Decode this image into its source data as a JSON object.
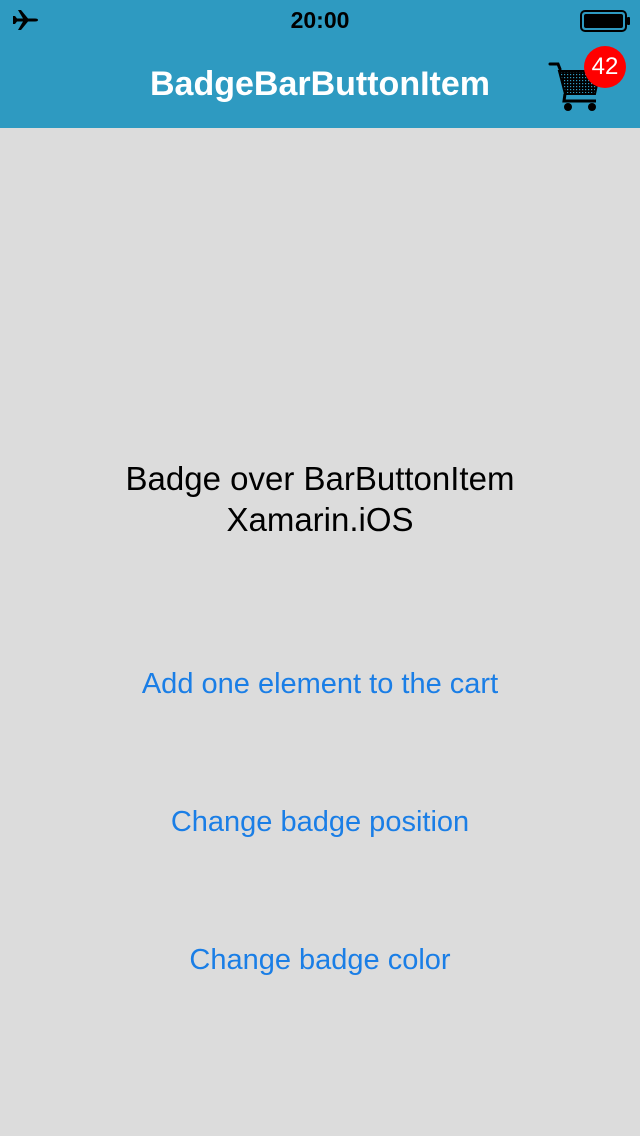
{
  "status_bar": {
    "time": "20:00",
    "left_icon": "airplane-icon",
    "right_icon": "battery-icon"
  },
  "nav_bar": {
    "title": "BadgeBarButtonItem",
    "cart_icon": "shopping-cart-icon",
    "badge_value": "42"
  },
  "main": {
    "description_line1": "Badge over BarButtonItem",
    "description_line2": "Xamarin.iOS",
    "buttons": [
      {
        "label": "Add one element to the cart"
      },
      {
        "label": "Change badge position"
      },
      {
        "label": "Change badge color"
      }
    ]
  },
  "colors": {
    "nav_background": "#2e9ac1",
    "page_background": "#dcdcdc",
    "badge_background": "#ff0000",
    "button_text": "#1a7ee6"
  }
}
